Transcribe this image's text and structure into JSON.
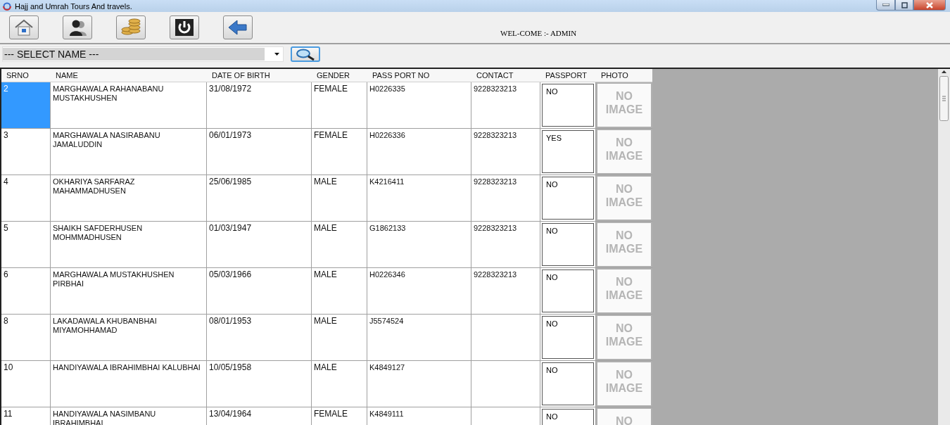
{
  "window": {
    "title": "Hajj and Umrah Tours And travels."
  },
  "toolbar": {
    "welcome": "WEL-COME :- ADMIN"
  },
  "search": {
    "value": "--- SELECT NAME ---"
  },
  "table": {
    "columns": [
      "SRNO",
      "NAME",
      "DATE OF BIRTH",
      "GENDER",
      "PASS PORT NO",
      "CONTACT",
      "PASSPORT",
      "PHOTO"
    ],
    "rows": [
      {
        "selected": true,
        "srno": "2",
        "name": "MARGHAWALA RAHANABANU MUSTAKHUSHEN",
        "dob": "31/08/1972",
        "gender": "FEMALE",
        "passport_no": "H0226335",
        "contact": "9228323213",
        "passport": "NO",
        "photo": "NO IMAGE"
      },
      {
        "selected": false,
        "srno": "3",
        "name": "MARGHAWALA NASIRABANU JAMALUDDIN",
        "dob": "06/01/1973",
        "gender": "FEMALE",
        "passport_no": "H0226336",
        "contact": "9228323213",
        "passport": "YES",
        "photo": "NO IMAGE"
      },
      {
        "selected": false,
        "srno": "4",
        "name": "OKHARIYA SARFARAZ MAHAMMADHUSEN",
        "dob": "25/06/1985",
        "gender": "MALE",
        "passport_no": "K4216411",
        "contact": "9228323213",
        "passport": "NO",
        "photo": "NO IMAGE"
      },
      {
        "selected": false,
        "srno": "5",
        "name": "SHAIKH SAFDERHUSEN MOHMMADHUSEN",
        "dob": "01/03/1947",
        "gender": "MALE",
        "passport_no": "G1862133",
        "contact": "9228323213",
        "passport": "NO",
        "photo": "NO IMAGE"
      },
      {
        "selected": false,
        "srno": "6",
        "name": "MARGHAWALA MUSTAKHUSHEN PIRBHAI",
        "dob": "05/03/1966",
        "gender": "MALE",
        "passport_no": "H0226346",
        "contact": "9228323213",
        "passport": "NO",
        "photo": "NO IMAGE"
      },
      {
        "selected": false,
        "srno": "8",
        "name": "LAKADAWALA KHUBANBHAI MIYAMOHHAMAD",
        "dob": "08/01/1953",
        "gender": "MALE",
        "passport_no": "J5574524",
        "contact": "",
        "passport": "NO",
        "photo": "NO IMAGE"
      },
      {
        "selected": false,
        "srno": "10",
        "name": "HANDIYAWALA IBRAHIMBHAI KALUBHAI",
        "dob": "10/05/1958",
        "gender": "MALE",
        "passport_no": "K4849127",
        "contact": "",
        "passport": "NO",
        "photo": "NO IMAGE"
      },
      {
        "selected": false,
        "srno": "11",
        "name": "HANDIYAWALA NASIMBANU IBRAHIMBHAI",
        "dob": "13/04/1964",
        "gender": "FEMALE",
        "passport_no": "K4849111",
        "contact": "",
        "passport": "NO",
        "photo": "NO"
      }
    ]
  }
}
